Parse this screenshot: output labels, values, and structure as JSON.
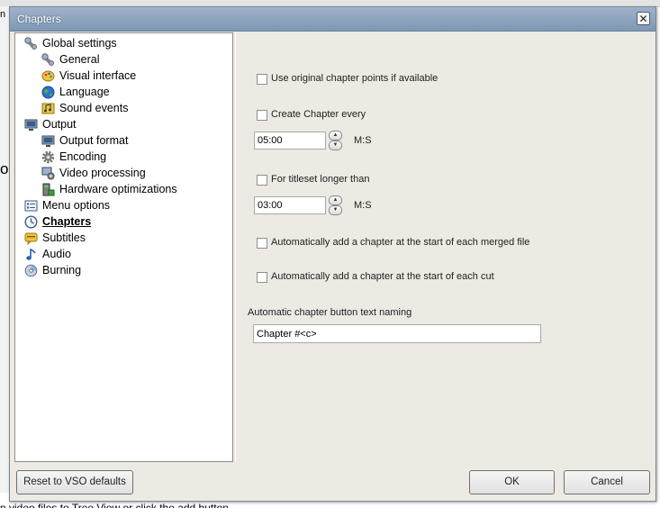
{
  "background": {
    "fragment_top": "n",
    "fragment_mid": "oa",
    "status_text": "n video files to Tree View or click the add button"
  },
  "dialog": {
    "title": "Chapters",
    "close_glyph": "✕"
  },
  "tree": {
    "items": [
      {
        "label": "Global settings",
        "icon": "wrench-icon"
      },
      {
        "label": "General",
        "icon": "wrench-icon"
      },
      {
        "label": "Visual interface",
        "icon": "palette-icon"
      },
      {
        "label": "Language",
        "icon": "globe-icon"
      },
      {
        "label": "Sound events",
        "icon": "sound-icon"
      },
      {
        "label": "Output",
        "icon": "monitor-icon"
      },
      {
        "label": "Output format",
        "icon": "monitor-icon"
      },
      {
        "label": "Encoding",
        "icon": "gear-icon"
      },
      {
        "label": "Video processing",
        "icon": "video-processing-icon"
      },
      {
        "label": "Hardware optimizations",
        "icon": "hardware-icon"
      },
      {
        "label": "Menu options",
        "icon": "menu-icon"
      },
      {
        "label": "Chapters",
        "icon": "clock-icon",
        "selected": true
      },
      {
        "label": "Subtitles",
        "icon": "subtitles-icon"
      },
      {
        "label": "Audio",
        "icon": "music-note-icon"
      },
      {
        "label": "Burning",
        "icon": "disc-icon"
      }
    ]
  },
  "settings": {
    "use_original_label": "Use original chapter points if available",
    "use_original_checked": false,
    "create_every_label": "Create Chapter every",
    "create_every_checked": false,
    "create_every_value": "05:00",
    "create_every_unit": "M:S",
    "titleset_label": "For titleset longer than",
    "titleset_checked": false,
    "titleset_value": "03:00",
    "titleset_unit": "M:S",
    "merged_label": "Automatically add a chapter at the start of each merged file",
    "merged_checked": false,
    "cut_label": "Automatically add a chapter at the start of each cut",
    "cut_checked": false,
    "naming_label": "Automatic chapter button text naming",
    "naming_value": "Chapter #<c>"
  },
  "buttons": {
    "reset": "Reset to VSO defaults",
    "ok": "OK",
    "cancel": "Cancel"
  }
}
